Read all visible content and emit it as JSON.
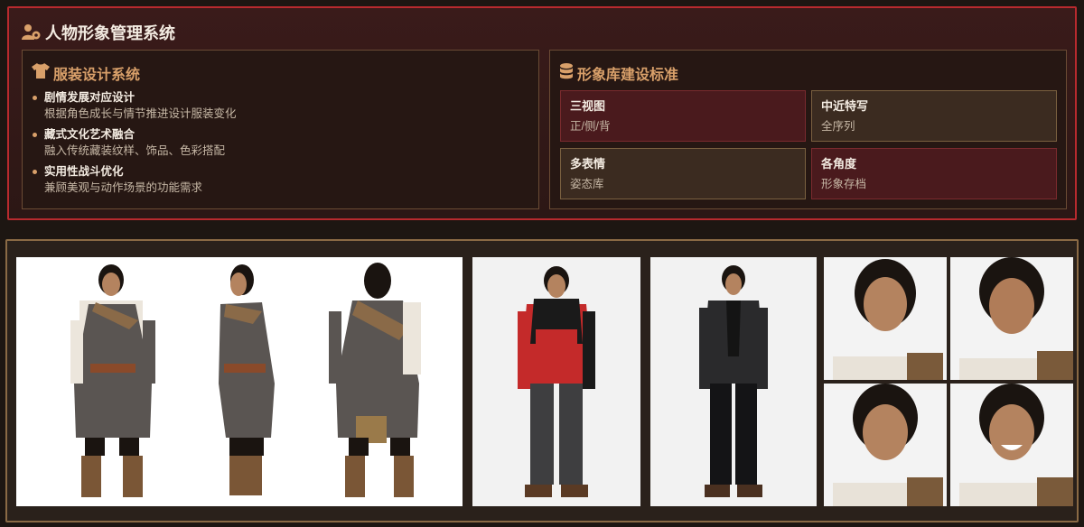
{
  "header": {
    "title": "人物形象管理系统",
    "icon": "users-gear-icon"
  },
  "costume": {
    "title": "服装设计系统",
    "icon": "shirt-icon",
    "items": [
      {
        "head": "剧情发展对应设计",
        "desc": "根据角色成长与情节推进设计服装变化"
      },
      {
        "head": "藏式文化艺术融合",
        "desc": "融入传统藏装纹样、饰品、色彩搭配"
      },
      {
        "head": "实用性战斗优化",
        "desc": "兼顾美观与动作场景的功能需求"
      }
    ]
  },
  "library": {
    "title": "形象库建设标准",
    "icon": "database-icon",
    "cells": [
      {
        "title": "三视图",
        "sub": "正/侧/背"
      },
      {
        "title": "中近特写",
        "sub": "全序列"
      },
      {
        "title": "多表情",
        "sub": "姿态库"
      },
      {
        "title": "各角度",
        "sub": "形象存档"
      }
    ]
  },
  "gallery": {
    "images": [
      "tibetan-costume-three-view",
      "red-jacket-full-body",
      "black-suit-full-body",
      "facial-expressions-grid"
    ]
  },
  "colors": {
    "accent": "#d9a06a",
    "border_red": "#b82a2e",
    "border_gold": "#8a6a45",
    "panel_bg": "#2c1715"
  }
}
